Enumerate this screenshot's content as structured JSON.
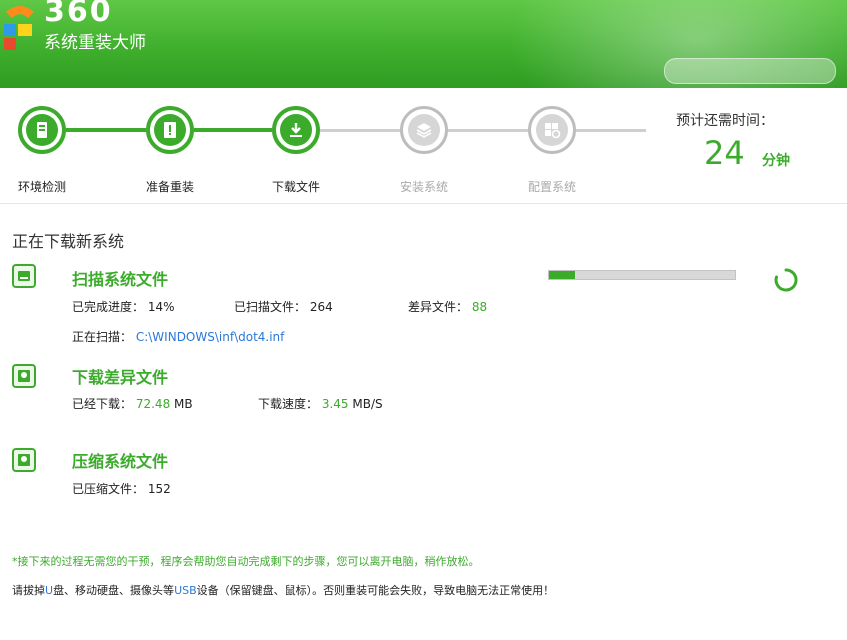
{
  "header": {
    "brand_number": "360",
    "brand_title": "系统重装大师",
    "brand_color": "#3faf2d"
  },
  "steps": [
    {
      "label": "环境检测",
      "state": "done",
      "icon": "computer-icon"
    },
    {
      "label": "准备重装",
      "state": "done",
      "icon": "document-icon"
    },
    {
      "label": "下载文件",
      "state": "done",
      "icon": "download-icon"
    },
    {
      "label": "安装系统",
      "state": "pending",
      "icon": "layers-icon"
    },
    {
      "label": "配置系统",
      "state": "pending",
      "icon": "windows-icon"
    }
  ],
  "remaining": {
    "label": "预计还需时间：",
    "value": "24",
    "unit": "分钟"
  },
  "main": {
    "section_title": "正在下载新系统"
  },
  "tasks": {
    "scan": {
      "title": "扫描系统文件",
      "progress_label": "已完成进度：",
      "progress_value": "14%",
      "progress_fraction": 0.14,
      "scanned_label": "已扫描文件：",
      "scanned_value": "264",
      "diff_label": "差异文件：",
      "diff_value": "88",
      "scanning_label": "正在扫描：",
      "scanning_path": "C:\\WINDOWS\\inf\\dot4.inf"
    },
    "download": {
      "title": "下载差异文件",
      "downloaded_label": "已经下载：",
      "downloaded_value": "72.48",
      "downloaded_unit": "MB",
      "speed_label": "下载速度：",
      "speed_value": "3.45",
      "speed_unit": "MB/S"
    },
    "compress": {
      "title": "压缩系统文件",
      "compressed_label": "已压缩文件：",
      "compressed_value": "152"
    }
  },
  "notices": {
    "line1": "*接下来的过程无需您的干预，程序会帮助您自动完成剩下的步骤，您可以离开电脑，稍作放松。",
    "line2_a": "请拔掉",
    "line2_b": "U",
    "line2_c": "盘、移动硬盘、摄像头等",
    "line2_d": "USB",
    "line2_e": "设备（保留键盘、鼠标）。否则重装可能会失败，导致电脑无法正常使用！"
  },
  "colors": {
    "accent": "#3cab2c",
    "link": "#2b78d8",
    "pending": "#bdbdbd"
  }
}
